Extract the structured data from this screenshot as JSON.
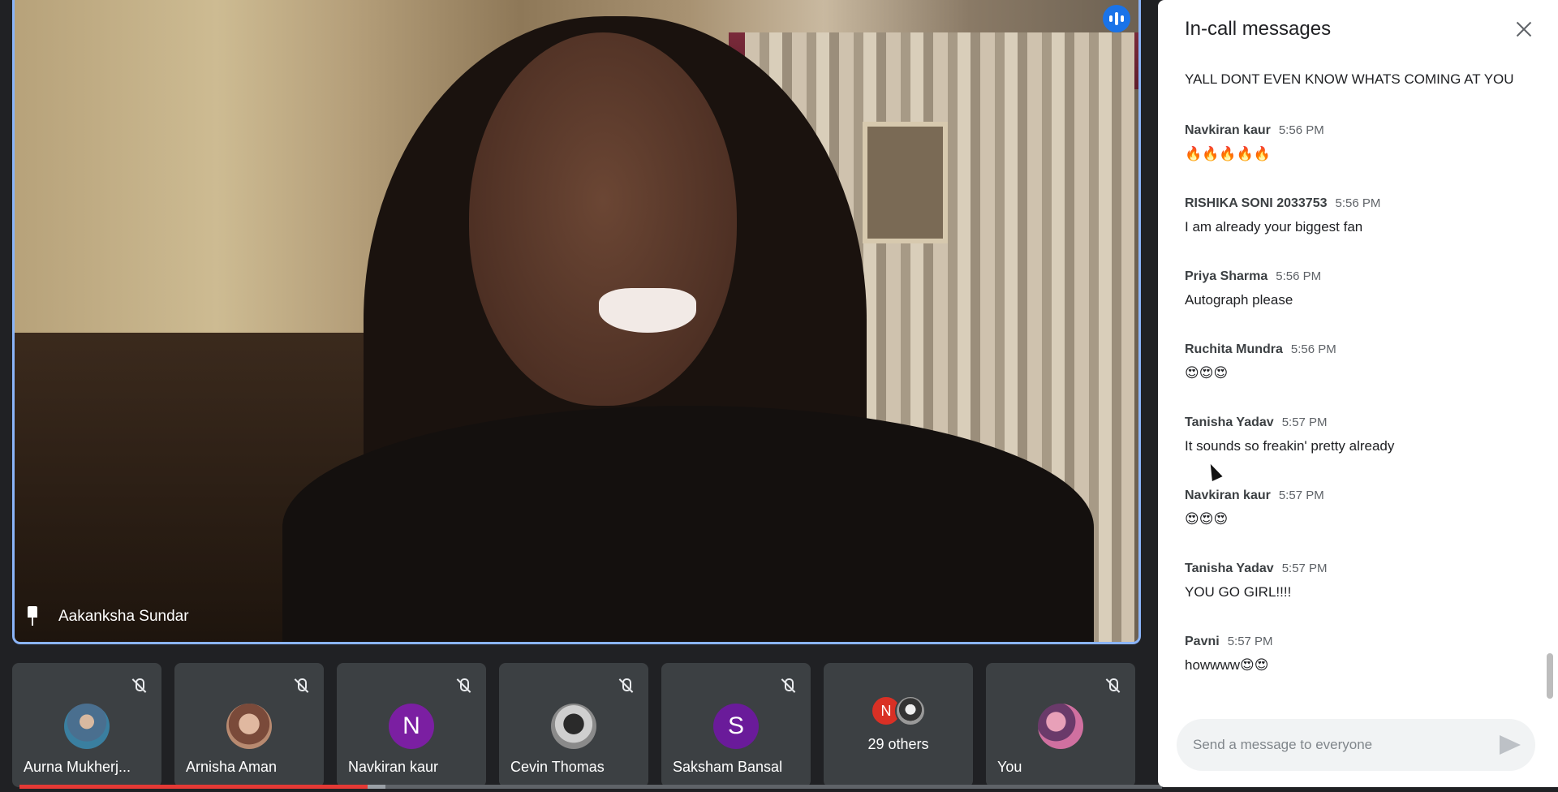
{
  "main_speaker": {
    "name": "Aakanksha Sundar"
  },
  "participants": [
    {
      "name": "Aurna Mukherj...",
      "avatar": "photo"
    },
    {
      "name": "Arnisha Aman",
      "avatar": "photo"
    },
    {
      "name": "Navkiran kaur",
      "avatar": "N"
    },
    {
      "name": "Cevin Thomas",
      "avatar": "photo"
    },
    {
      "name": "Saksham Bansal",
      "avatar": "S"
    },
    {
      "name": "29 others",
      "avatar": "N"
    },
    {
      "name": "You",
      "avatar": "photo"
    }
  ],
  "chat": {
    "title": "In-call messages",
    "first_message": "YALL DONT EVEN KNOW WHATS COMING AT YOU",
    "messages": [
      {
        "sender": "Navkiran kaur",
        "time": "5:56 PM",
        "text": "🔥🔥🔥🔥🔥"
      },
      {
        "sender": "RISHIKA SONI 2033753",
        "time": "5:56 PM",
        "text": "I am already your biggest fan"
      },
      {
        "sender": "Priya Sharma",
        "time": "5:56 PM",
        "text": "Autograph please"
      },
      {
        "sender": "Ruchita Mundra",
        "time": "5:56 PM",
        "text": "😍😍😍"
      },
      {
        "sender": "Tanisha Yadav",
        "time": "5:57 PM",
        "text": "It sounds so freakin' pretty already"
      },
      {
        "sender": "Navkiran kaur",
        "time": "5:57 PM",
        "text": "😍😍😍"
      },
      {
        "sender": "Tanisha Yadav",
        "time": "5:57 PM",
        "text": "YOU GO GIRL!!!!"
      },
      {
        "sender": "Pavni",
        "time": "5:57 PM",
        "text": "howwww😍😍"
      }
    ],
    "compose_placeholder": "Send a message to everyone"
  },
  "playback": {
    "progress": 0.305,
    "buffered": 0.32
  },
  "colors": {
    "accent": "#8ab4f8",
    "speaking": "#1a73e8",
    "progress": "#e53935"
  }
}
